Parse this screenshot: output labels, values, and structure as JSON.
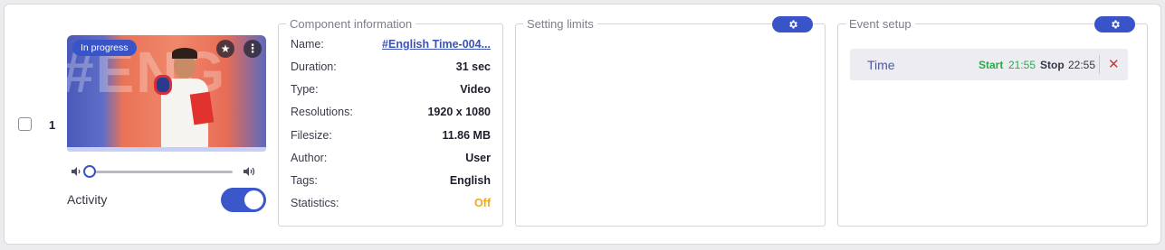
{
  "row": {
    "index": "1",
    "checked": false
  },
  "media": {
    "status_badge": "In progress",
    "thumbnail_text": "#ENG",
    "volume": 0.0,
    "activity_label": "Activity",
    "activity_enabled": true
  },
  "component_info": {
    "legend": "Component information",
    "rows": [
      {
        "key": "Name:",
        "value": "#English Time-004..."
      },
      {
        "key": "Duration:",
        "value": "31 sec"
      },
      {
        "key": "Type:",
        "value": "Video"
      },
      {
        "key": "Resolutions:",
        "value": "1920 x 1080"
      },
      {
        "key": "Filesize:",
        "value": "11.86 MB"
      },
      {
        "key": "Author:",
        "value": "User"
      },
      {
        "key": "Tags:",
        "value": "English"
      },
      {
        "key": "Statistics:",
        "value": "Off"
      }
    ]
  },
  "setting_limits": {
    "legend": "Setting limits"
  },
  "event_setup": {
    "legend": "Event setup",
    "events": [
      {
        "name": "Time",
        "start_label": "Start",
        "start_time": "21:55",
        "stop_label": "Stop",
        "stop_time": "22:55"
      }
    ]
  },
  "colors": {
    "accent": "#3954c8",
    "start_green": "#2ea84d",
    "off_orange": "#f2a81d",
    "delete_red": "#d33535"
  }
}
